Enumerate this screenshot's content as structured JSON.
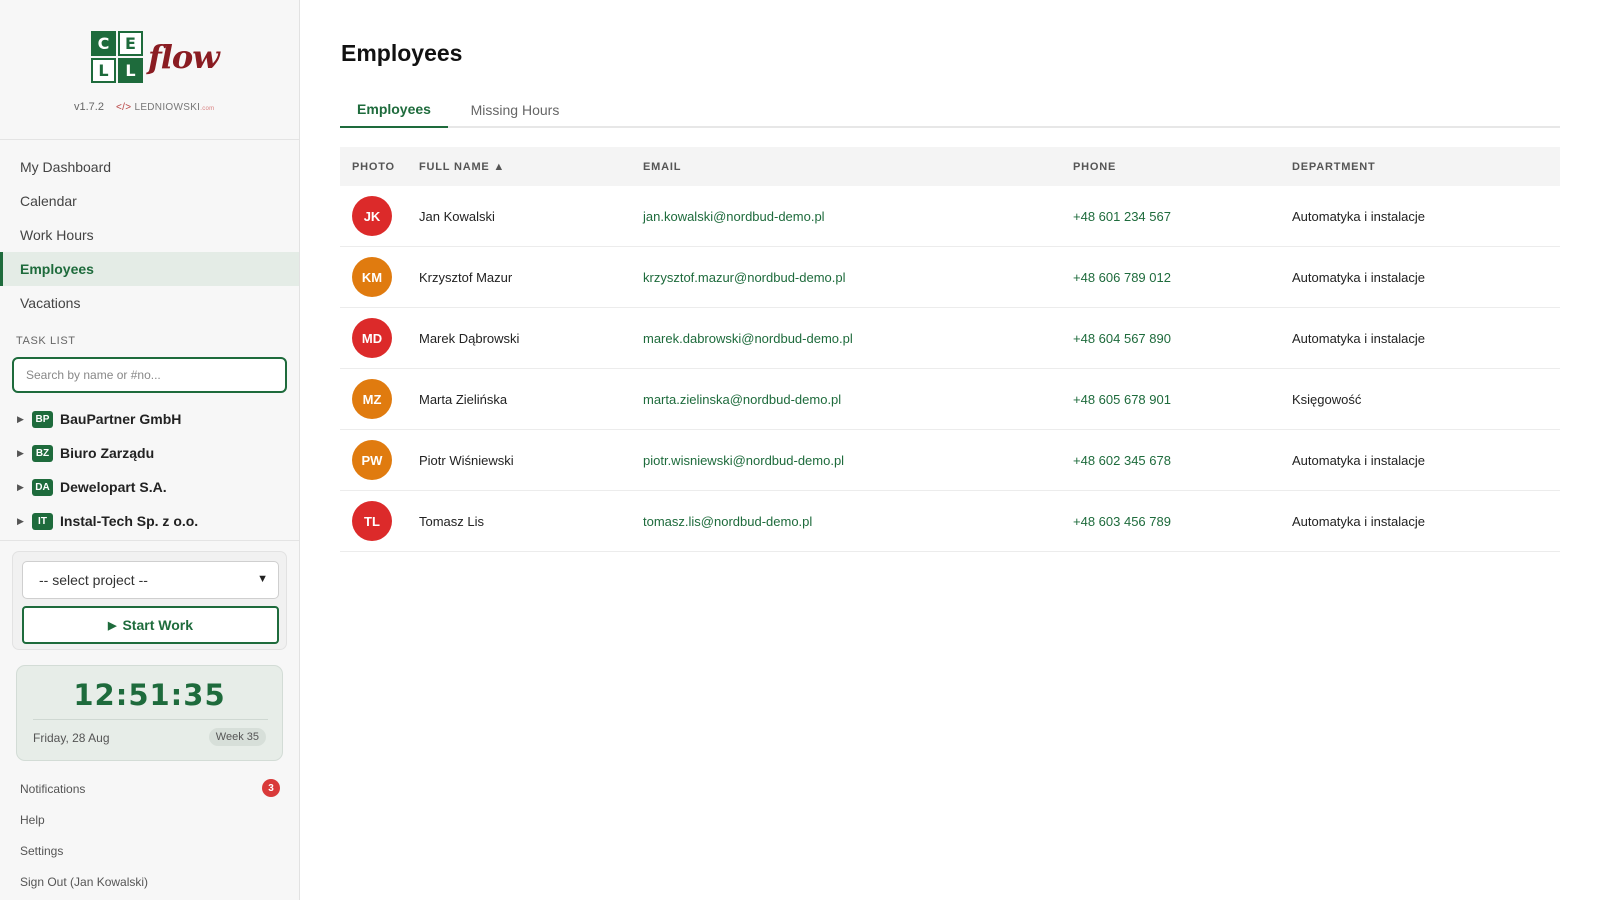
{
  "logo": {
    "letters": [
      "C",
      "E",
      "L",
      "L"
    ],
    "word": "flow",
    "version": "v1.7.2",
    "maker_tag": "</>",
    "maker_name": "LEDNIOWSKI",
    "maker_suffix": ".com"
  },
  "nav": {
    "items": [
      {
        "label": "My Dashboard",
        "active": false
      },
      {
        "label": "Calendar",
        "active": false
      },
      {
        "label": "Work Hours",
        "active": false
      },
      {
        "label": "Employees",
        "active": true
      },
      {
        "label": "Vacations",
        "active": false
      }
    ]
  },
  "tasklist": {
    "label": "TASK LIST",
    "search_placeholder": "Search by name or #no...",
    "items": [
      {
        "code": "BP",
        "name": "BauPartner GmbH"
      },
      {
        "code": "BZ",
        "name": "Biuro Zarządu"
      },
      {
        "code": "DA",
        "name": "Dewelopart S.A."
      },
      {
        "code": "IT",
        "name": "Instal-Tech Sp. z o.o."
      }
    ]
  },
  "work": {
    "select_value": "-- select project --",
    "start_label": "Start Work"
  },
  "clock": {
    "time": "12:51:35",
    "date": "Friday, 28 Aug",
    "week": "Week 35"
  },
  "footer": {
    "notifications_label": "Notifications",
    "notifications_count": "3",
    "help_label": "Help",
    "settings_label": "Settings",
    "signout_label": "Sign Out (Jan Kowalski)"
  },
  "page": {
    "title": "Employees",
    "tabs": [
      {
        "label": "Employees",
        "active": true
      },
      {
        "label": "Missing Hours",
        "active": false
      }
    ]
  },
  "table": {
    "headers": {
      "photo": "PHOTO",
      "name": "FULL NAME ▲",
      "email": "EMAIL",
      "phone": "PHONE",
      "department": "DEPARTMENT"
    },
    "rows": [
      {
        "initials": "JK",
        "color": "#dc2a2a",
        "name": "Jan Kowalski",
        "email": "jan.kowalski@nordbud-demo.pl",
        "phone": "+48 601 234 567",
        "department": "Automatyka i instalacje"
      },
      {
        "initials": "KM",
        "color": "#e07b0f",
        "name": "Krzysztof Mazur",
        "email": "krzysztof.mazur@nordbud-demo.pl",
        "phone": "+48 606 789 012",
        "department": "Automatyka i instalacje"
      },
      {
        "initials": "MD",
        "color": "#dc2a2a",
        "name": "Marek Dąbrowski",
        "email": "marek.dabrowski@nordbud-demo.pl",
        "phone": "+48 604 567 890",
        "department": "Automatyka i instalacje"
      },
      {
        "initials": "MZ",
        "color": "#e07b0f",
        "name": "Marta Zielińska",
        "email": "marta.zielinska@nordbud-demo.pl",
        "phone": "+48 605 678 901",
        "department": "Księgowość"
      },
      {
        "initials": "PW",
        "color": "#e07b0f",
        "name": "Piotr Wiśniewski",
        "email": "piotr.wisniewski@nordbud-demo.pl",
        "phone": "+48 602 345 678",
        "department": "Automatyka i instalacje"
      },
      {
        "initials": "TL",
        "color": "#dc2a2a",
        "name": "Tomasz Lis",
        "email": "tomasz.lis@nordbud-demo.pl",
        "phone": "+48 603 456 789",
        "department": "Automatyka i instalacje"
      }
    ]
  }
}
